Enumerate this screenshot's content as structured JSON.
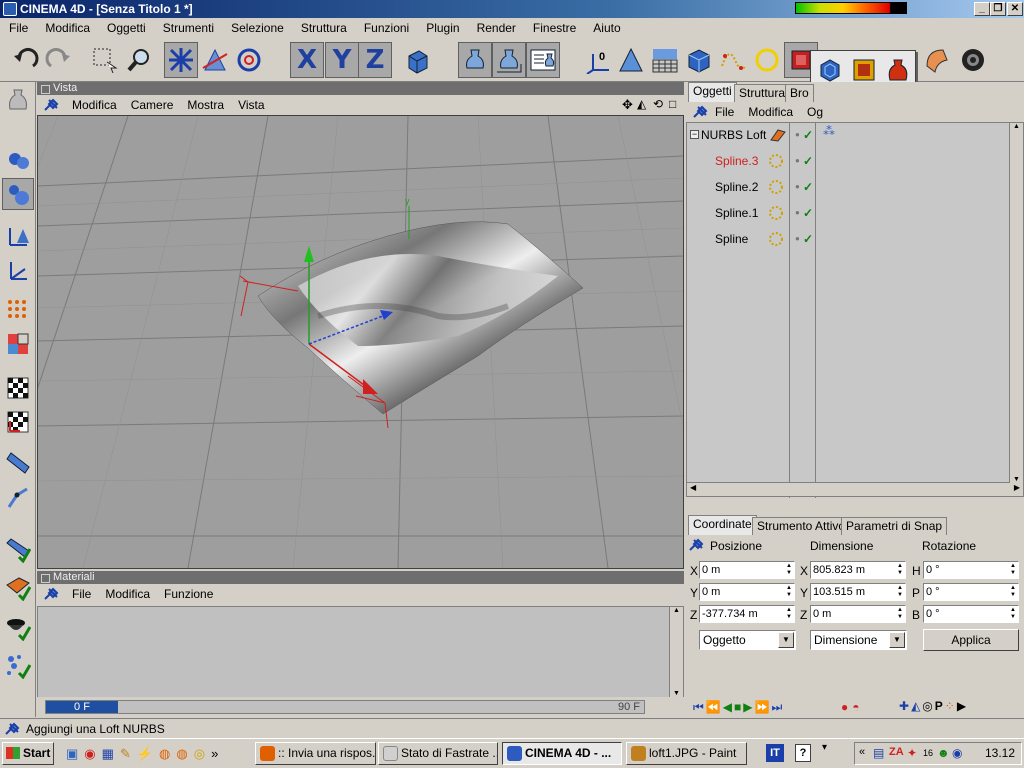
{
  "window": {
    "title": "CINEMA 4D - [Senza Titolo 1 *]",
    "controls": [
      "_",
      "❐",
      "✕"
    ]
  },
  "menubar": [
    "File",
    "Modifica",
    "Oggetti",
    "Strumenti",
    "Selezione",
    "Struttura",
    "Funzioni",
    "Plugin",
    "Render",
    "Finestre",
    "Aiuto"
  ],
  "toolbar": {
    "axis_labels": [
      "X",
      "Y",
      "Z"
    ],
    "icons": [
      "undo-icon",
      "redo-icon",
      "select-icon",
      "zoom-icon",
      "move-icon",
      "scale-icon",
      "rotate-icon",
      "x-axis-icon",
      "y-axis-icon",
      "z-axis-icon",
      "world-icon",
      "render-view-icon",
      "render-icon",
      "render-settings-icon",
      "null-object-icon",
      "light-icon",
      "floor-icon",
      "cube-icon",
      "spline-icon",
      "circle-spline-icon",
      "nurbs-icon",
      "deformer-icon",
      "camera-icon"
    ]
  },
  "viewport": {
    "header": "Vista",
    "menu": [
      "Modifica",
      "Camere",
      "Mostra",
      "Vista"
    ],
    "axis_label": "y"
  },
  "objects": {
    "tabs": [
      "Oggetti",
      "Struttura",
      "Bro"
    ],
    "menu": [
      "File",
      "Modifica",
      "Og"
    ],
    "items": [
      {
        "name": "NURBS Loft",
        "selected": false
      },
      {
        "name": "Spline.3",
        "selected": true
      },
      {
        "name": "Spline.2",
        "selected": false
      },
      {
        "name": "Spline.1",
        "selected": false
      },
      {
        "name": "Spline",
        "selected": false
      }
    ]
  },
  "materials": {
    "header": "Materiali",
    "menu": [
      "File",
      "Modifica",
      "Funzione"
    ]
  },
  "timeline": {
    "current_frame": "0 F",
    "end_frame": "90 F"
  },
  "coords": {
    "tabs": [
      "Coordinate",
      "Strumento Attivo",
      "Parametri di Snap"
    ],
    "headers": [
      "Posizione",
      "Dimensione",
      "Rotazione"
    ],
    "position": {
      "labels": [
        "X",
        "Y",
        "Z"
      ],
      "values": [
        "0 m",
        "0 m",
        "-377.734 m"
      ]
    },
    "size": {
      "labels": [
        "X",
        "Y",
        "Z"
      ],
      "values": [
        "805.823 m",
        "103.515 m",
        "0 m"
      ]
    },
    "rotation": {
      "labels": [
        "H",
        "P",
        "B"
      ],
      "values": [
        "0 °",
        "0 °",
        "0 °"
      ]
    },
    "mode_select": "Oggetto",
    "size_select": "Dimensione",
    "apply_label": "Applica"
  },
  "status": "Aggiungi una Loft NURBS",
  "taskbar": {
    "start": "Start",
    "tasks": [
      {
        "label": ":: Invia una rispos...",
        "active": false
      },
      {
        "label": "Stato di Fastrate ...",
        "active": false
      },
      {
        "label": "CINEMA 4D - ...",
        "active": true
      },
      {
        "label": "loft1.JPG - Paint",
        "active": false
      }
    ],
    "lang": "IT",
    "clock": "13.12",
    "tray_num": "16"
  }
}
